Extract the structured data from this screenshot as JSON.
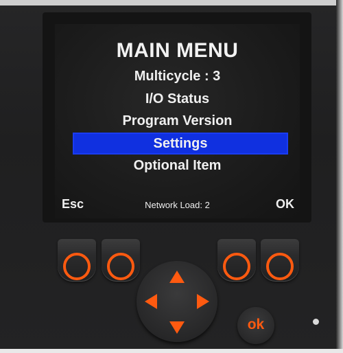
{
  "screen": {
    "title": "MAIN MENU",
    "items": [
      {
        "label": "Multicycle : 3",
        "selected": false
      },
      {
        "label": "I/O Status",
        "selected": false
      },
      {
        "label": "Program Version",
        "selected": false
      },
      {
        "label": "Settings",
        "selected": true
      },
      {
        "label": "Optional Item",
        "selected": false
      }
    ],
    "softkey_left": "Esc",
    "softkey_right": "OK",
    "status": "Network Load: 2"
  },
  "keypad": {
    "ok_label": "ok"
  },
  "colors": {
    "accent": "#ff5a10",
    "selection": "#1030e0",
    "screen_text": "#f0f0f0"
  }
}
